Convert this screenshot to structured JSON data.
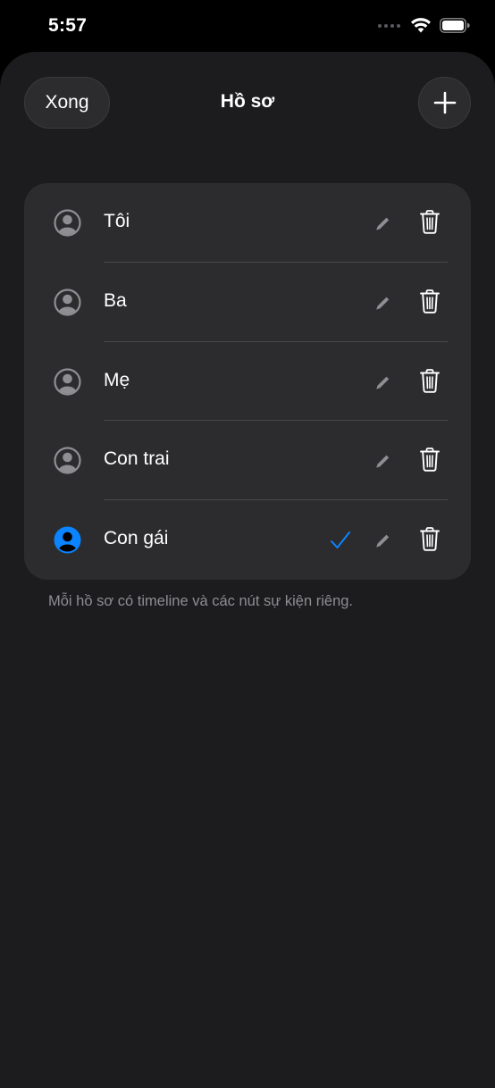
{
  "status_bar": {
    "time": "5:57",
    "icons": [
      "cellular-signal-icon",
      "wifi-icon",
      "battery-icon"
    ]
  },
  "nav": {
    "done_label": "Xong",
    "title": "Hồ sơ",
    "add_icon": "plus-icon"
  },
  "profiles": [
    {
      "name": "Tôi",
      "selected": false
    },
    {
      "name": "Ba",
      "selected": false
    },
    {
      "name": "Mẹ",
      "selected": false
    },
    {
      "name": "Con trai",
      "selected": false
    },
    {
      "name": "Con gái",
      "selected": true
    }
  ],
  "footer": {
    "note": "Mỗi hồ sơ có timeline và các nút sự kiện riêng."
  },
  "colors": {
    "accent": "#0a84ff",
    "background": "#1c1c1e",
    "card": "#2c2c2e",
    "secondary_text": "#8e8e93",
    "icon_gray": "#8e8e93"
  }
}
